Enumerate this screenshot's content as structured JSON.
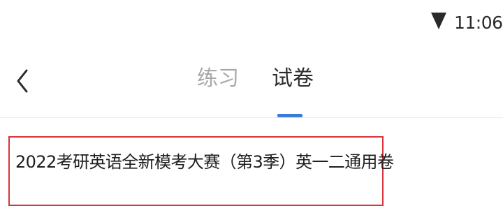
{
  "status_bar": {
    "time": "11:06",
    "signal_icon": "wifi-icon"
  },
  "header": {
    "back_icon": "chevron-left-icon",
    "tabs": [
      {
        "label": "练习",
        "active": false
      },
      {
        "label": "试卷",
        "active": true
      }
    ],
    "active_color": "#3b7bd9",
    "inactive_color": "#a8a8a8"
  },
  "papers": [
    {
      "title": "2022考研英语全新模考大赛（第3季）英一二通用卷",
      "highlight_color": "#d9343a"
    }
  ]
}
